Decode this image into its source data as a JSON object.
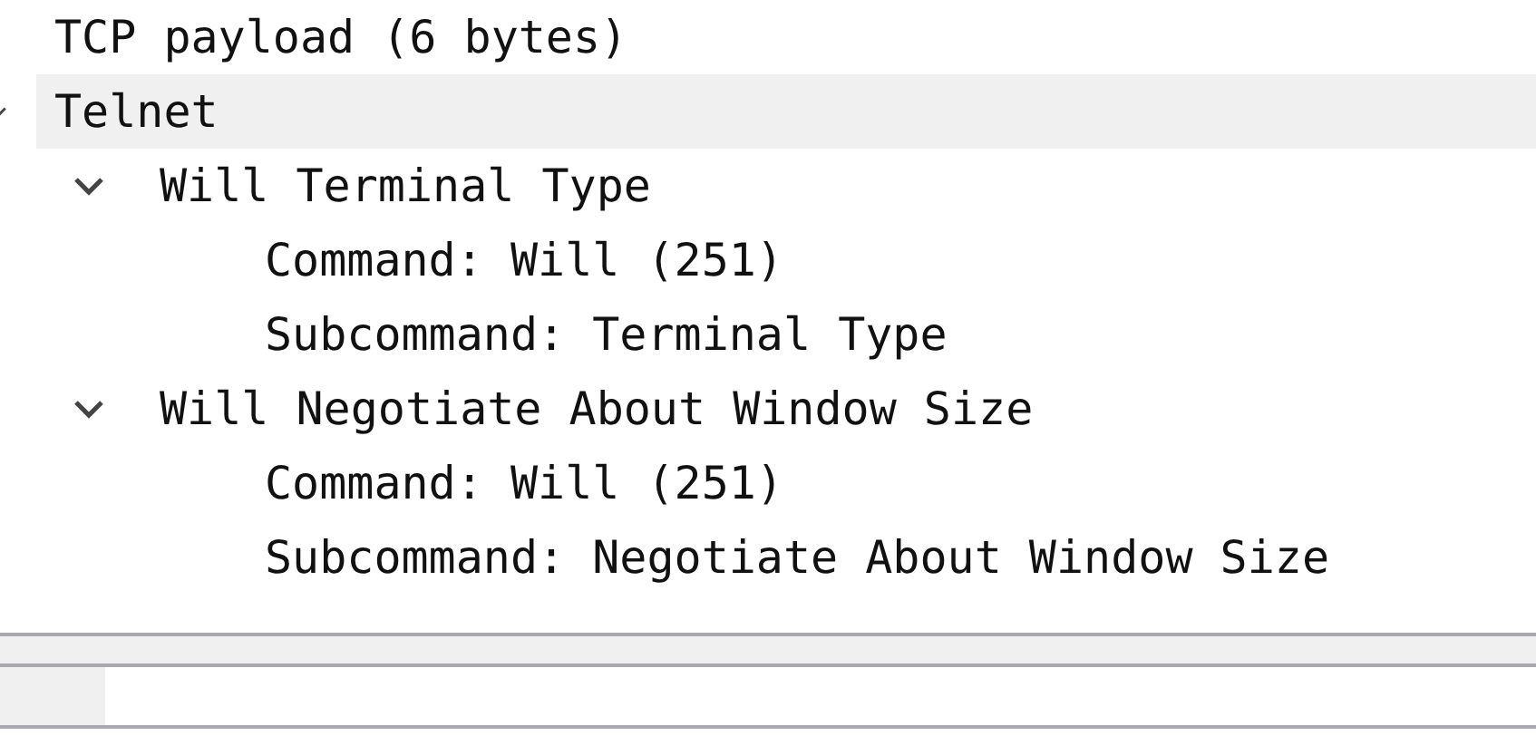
{
  "tree": [
    {
      "label": "TCP payload (6 bytes)",
      "selected": false
    },
    {
      "label": "Telnet",
      "selected": true,
      "expanded": true,
      "children": [
        {
          "label": "Will Terminal Type",
          "selected": false,
          "expanded": true,
          "children": [
            {
              "label": "Command: Will (251)",
              "selected": false
            },
            {
              "label": "Subcommand: Terminal Type",
              "selected": false
            }
          ]
        },
        {
          "label": "Will Negotiate About Window Size",
          "selected": false,
          "expanded": true,
          "children": [
            {
              "label": "Command: Will (251)",
              "selected": false
            },
            {
              "label": "Subcommand: Negotiate About Window Size",
              "selected": false
            }
          ]
        }
      ]
    }
  ]
}
